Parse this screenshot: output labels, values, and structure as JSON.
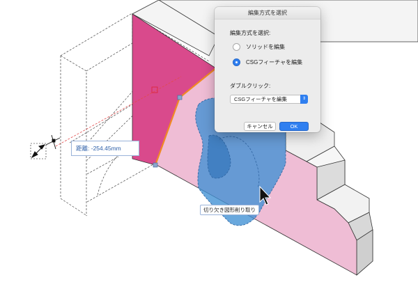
{
  "dialog": {
    "title": "編集方式を選択",
    "section_label": "編集方式を選択:",
    "options": [
      {
        "label": "ソリッドを編集",
        "selected": false
      },
      {
        "label": "CSGフィーチャを編集",
        "selected": true
      }
    ],
    "double_click_label": "ダブルクリック:",
    "double_click_value": "CSGフィーチャを編集",
    "cancel_label": "キャンセル",
    "ok_label": "OK"
  },
  "canvas": {
    "distance_label": "距離:",
    "distance_value": "-254.45mm",
    "tooltip": "切り欠き図形削り取り"
  },
  "colors": {
    "face_magenta": "#d94a8c",
    "face_pink": "#efbdd5",
    "csg_blue": "#3f8fd4",
    "accent_blue": "#2f7ff0",
    "edge_orange": "#f08a24"
  }
}
